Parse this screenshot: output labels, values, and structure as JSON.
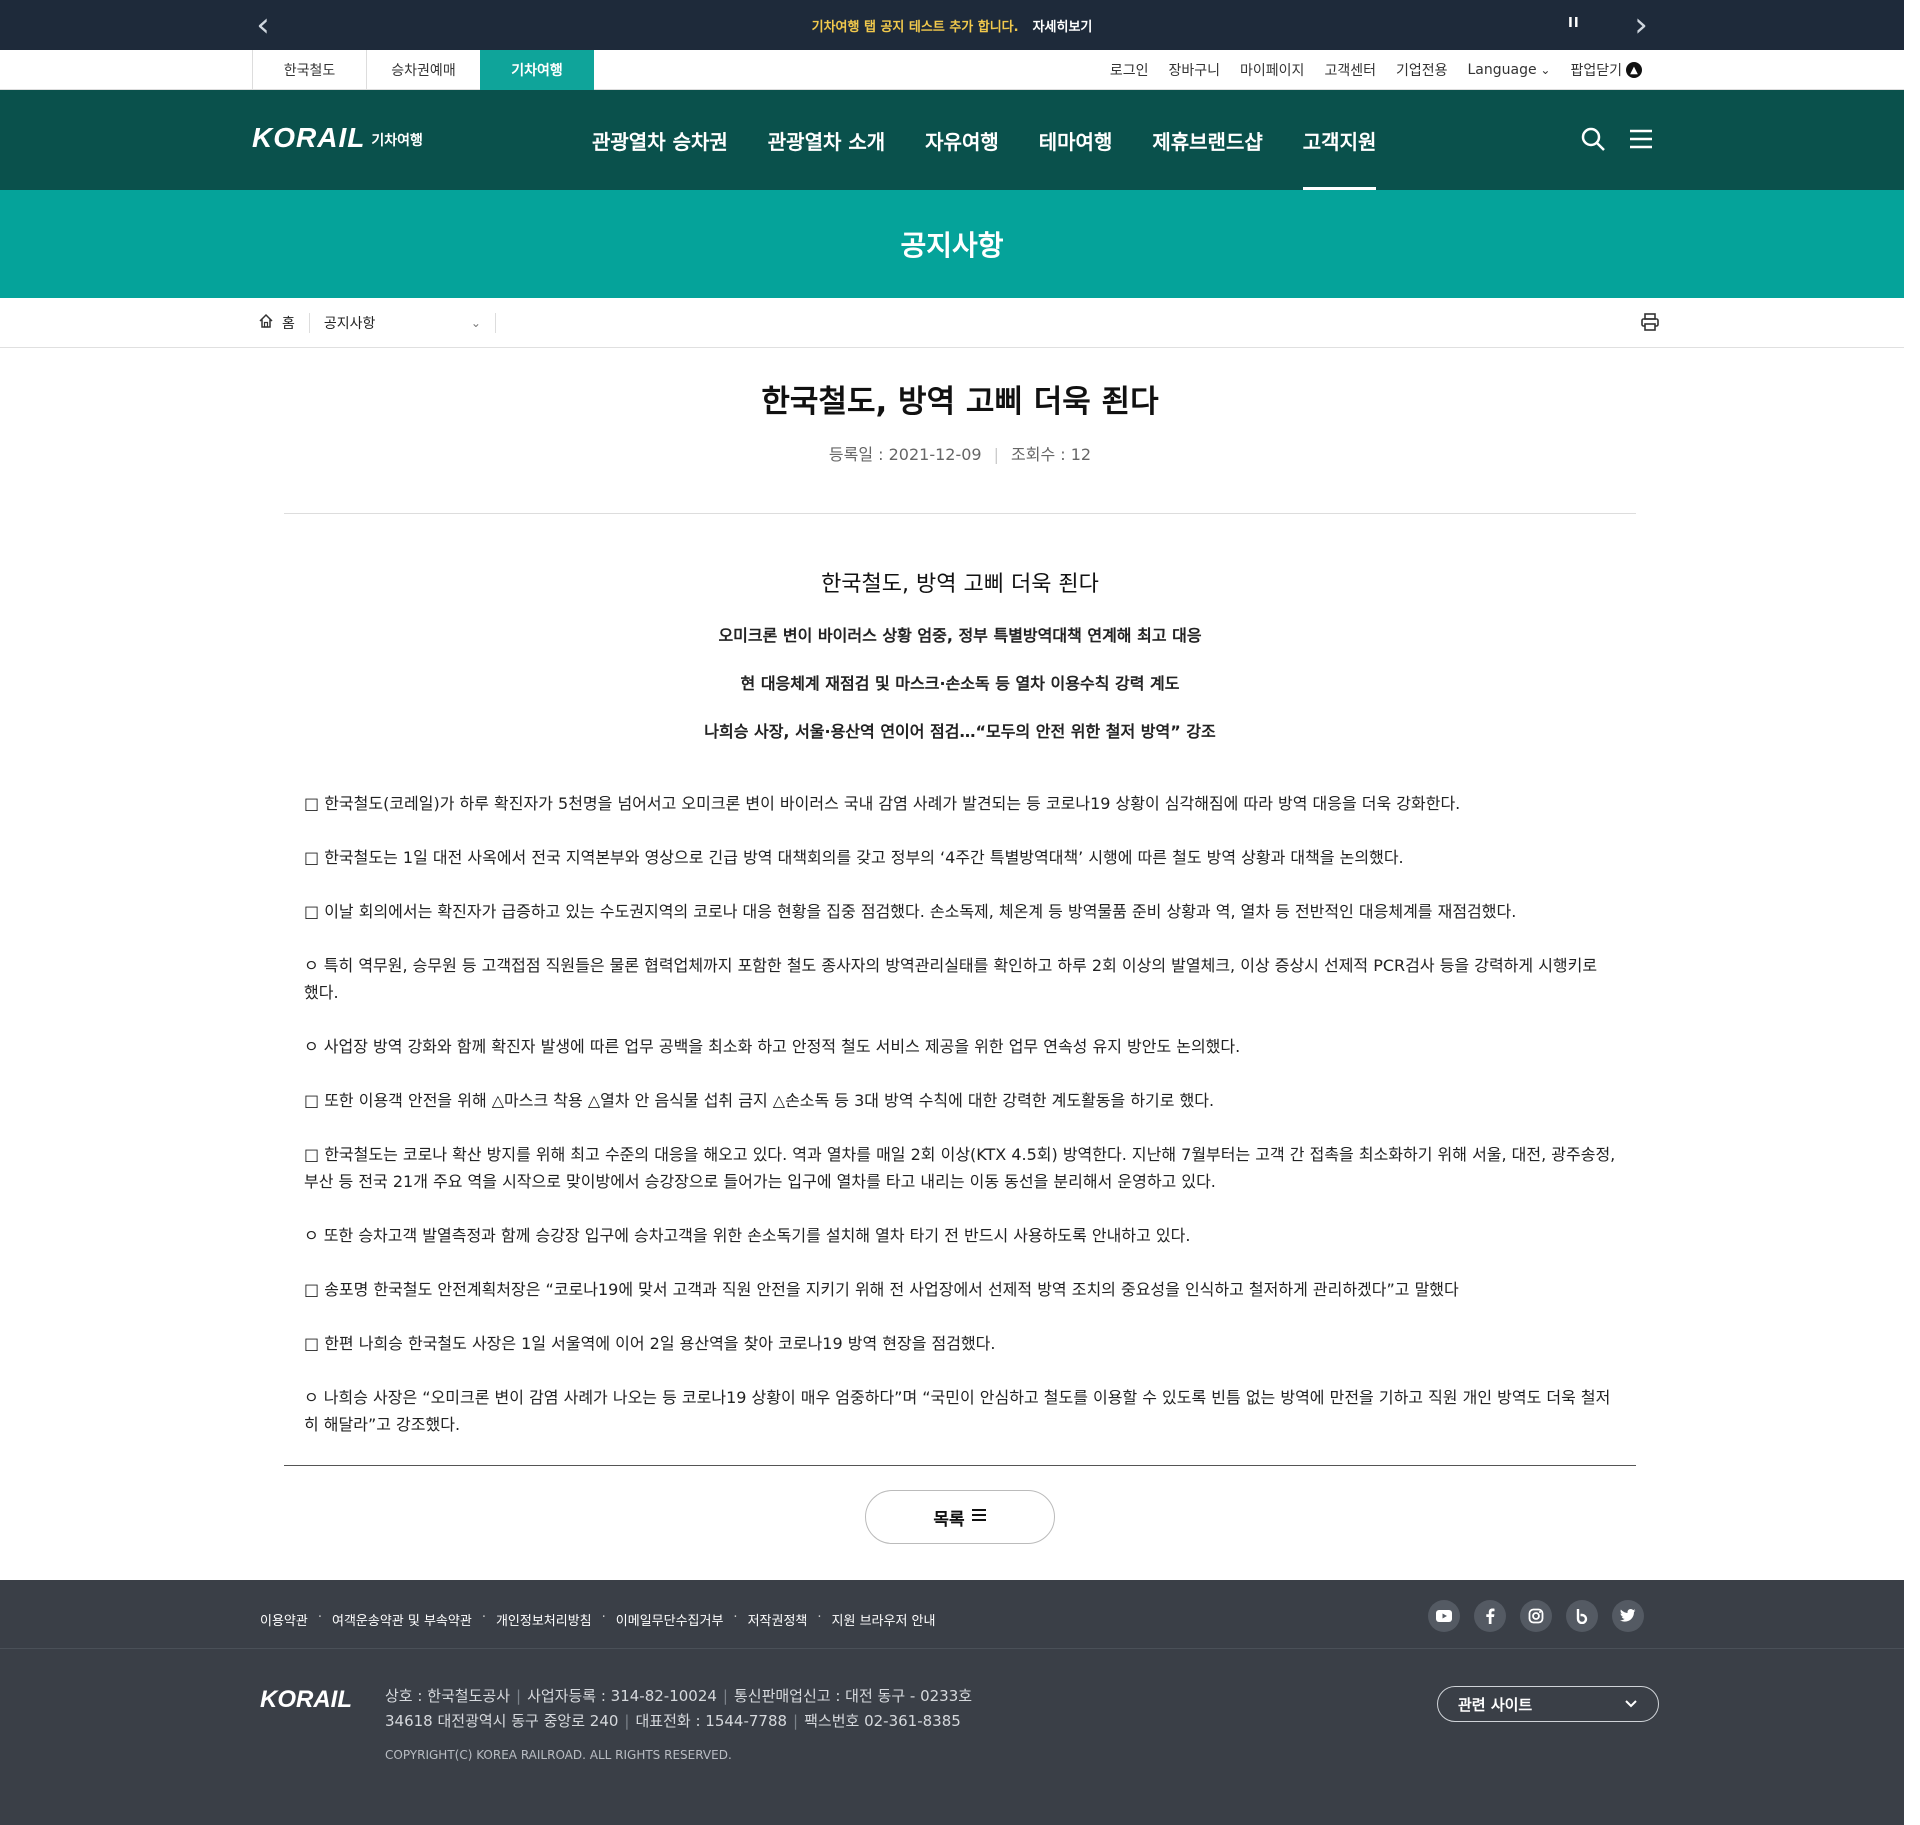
{
  "topbar": {
    "notice": "기차여행 탭 공지 테스트 추가 합니다.",
    "more": "자세히보기",
    "pause": "II"
  },
  "site_tabs": [
    "한국철도",
    "승차권예매",
    "기차여행"
  ],
  "util_links": {
    "login": "로그인",
    "cart": "장바구니",
    "mypage": "마이페이지",
    "customer": "고객센터",
    "corporate": "기업전용",
    "language": "Language",
    "popup_close": "팝업닫기"
  },
  "logo": {
    "brand": "KORAIL",
    "sub": "기차여행"
  },
  "gnb": [
    "관광열차 승차권",
    "관광열차 소개",
    "자유여행",
    "테마여행",
    "제휴브랜드샵",
    "고객지원"
  ],
  "page_title": "공지사항",
  "breadcrumb": {
    "home": "홈",
    "current": "공지사항"
  },
  "article": {
    "title": "한국철도, 방역 고삐 더욱 죈다",
    "date": "등록일 : 2021-12-09",
    "views": "조회수 : 12",
    "heading": "한국철도, 방역 고삐 더욱 죈다",
    "subheads": [
      "오미크론 변이 바이러스 상황 엄중, 정부 특별방역대책 연계해 최고 대응",
      "현 대응체계 재점검 및 마스크·손소독 등 열차 이용수칙 강력 계도",
      "나희승 사장, 서울·용산역 연이어 점검…“모두의 안전 위한 철저 방역” 강조"
    ],
    "paragraphs": [
      "□ 한국철도(코레일)가 하루 확진자가 5천명을 넘어서고 오미크론 변이 바이러스 국내 감염 사례가 발견되는 등 코로나19 상황이 심각해짐에 따라 방역 대응을 더욱 강화한다.",
      "□ 한국철도는 1일 대전 사옥에서 전국 지역본부와 영상으로 긴급 방역 대책회의를 갖고 정부의 ‘4주간 특별방역대책’ 시행에 따른 철도 방역 상황과 대책을 논의했다.",
      "□ 이날 회의에서는 확진자가 급증하고 있는 수도권지역의 코로나 대응 현황을 집중 점검했다. 손소독제, 체온계 등 방역물품 준비 상황과 역, 열차 등 전반적인 대응체계를 재점검했다.",
      "ㅇ 특히 역무원, 승무원 등 고객접점 직원들은 물론 협력업체까지 포함한 철도 종사자의 방역관리실태를 확인하고 하루 2회 이상의 발열체크, 이상 증상시 선제적 PCR검사 등을 강력하게 시행키로 했다.",
      "ㅇ 사업장 방역 강화와 함께 확진자 발생에 따른 업무 공백을 최소화 하고 안정적 철도 서비스 제공을 위한 업무 연속성 유지 방안도 논의했다.",
      "□ 또한 이용객 안전을 위해 △마스크 착용 △열차 안 음식물 섭취 금지 △손소독 등 3대 방역 수칙에 대한 강력한 계도활동을 하기로 했다.",
      "□ 한국철도는 코로나 확산 방지를 위해 최고 수준의 대응을 해오고 있다. 역과 열차를 매일 2회 이상(KTX 4.5회) 방역한다. 지난해 7월부터는 고객 간 접촉을 최소화하기 위해 서울, 대전, 광주송정, 부산 등 전국 21개 주요 역을 시작으로 맞이방에서 승강장으로 들어가는 입구에 열차를 타고 내리는 이동 동선을 분리해서 운영하고 있다.",
      "ㅇ 또한 승차고객 발열측정과 함께 승강장 입구에 승차고객을 위한 손소독기를 설치해 열차 타기 전 반드시 사용하도록 안내하고 있다.",
      "□ 송포명 한국철도 안전계획처장은 “코로나19에 맞서 고객과 직원 안전을 지키기 위해 전 사업장에서 선제적 방역 조치의 중요성을 인식하고 철저하게 관리하겠다”고 말했다",
      "□ 한편 나희승 한국철도 사장은 1일 서울역에 이어 2일 용산역을 찾아 코로나19 방역 현장을 점검했다.",
      "  ㅇ 나희승 사장은 “오미크론 변이 감염 사례가 나오는 등 코로나19 상황이 매우 엄중하다”며 “국민이 안심하고 철도를 이용할 수 있도록 빈틈 없는 방역에 만전을 기하고 직원 개인 방역도 더욱 철저히 해달라”고 강조했다."
    ],
    "list_button": "목록"
  },
  "footer": {
    "links": [
      "이용약관",
      "여객운송약관 및 부속약관",
      "개인정보처리방침",
      "이메일무단수집거부",
      "저작권정책",
      "지원 브라우저 안내"
    ],
    "social": [
      "youtube-icon",
      "facebook-icon",
      "instagram-icon",
      "blog-icon",
      "twitter-icon"
    ],
    "logo": "KORAIL",
    "company": "상호 : 한국철도공사",
    "biz_no": "사업자등록 : 314-82-10024",
    "mail_order": "통신판매업신고 : 대전 동구 - 0233호",
    "address": "34618 대전광역시 동구 중앙로 240",
    "phone": "대표전화 : 1544-7788",
    "fax": "팩스번호 02-361-8385",
    "copyright": "COPYRIGHT(C) KOREA RAILROAD. ALL RIGHTS RESERVED.",
    "related": "관련 사이트"
  },
  "colors": {
    "topbar": "#1e2a3a",
    "gnb": "#0a514c",
    "accent": "#05a39a",
    "footer": "#3a3f47"
  }
}
